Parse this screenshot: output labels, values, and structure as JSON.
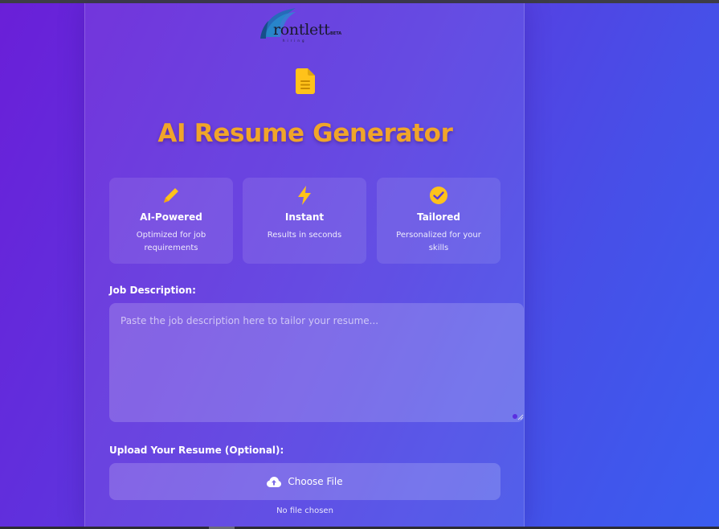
{
  "brand": {
    "name": "rontlett",
    "badge": "BETA",
    "tagline": "hiring"
  },
  "page": {
    "title": "AI Resume Generator",
    "title_color": "#f0a52a",
    "accent_color": "#ffc21a"
  },
  "features": [
    {
      "icon": "pencil-icon",
      "title": "AI-Powered",
      "description": "Optimized for job requirements"
    },
    {
      "icon": "lightning-icon",
      "title": "Instant",
      "description": "Results in seconds"
    },
    {
      "icon": "check-circle-icon",
      "title": "Tailored",
      "description": "Personalized for your skills"
    }
  ],
  "job_description": {
    "label": "Job Description:",
    "placeholder": "Paste the job description here to tailor your resume...",
    "value": ""
  },
  "upload": {
    "label": "Upload Your Resume (Optional):",
    "button_label": "Choose File",
    "icon": "cloud-upload-icon",
    "status": "No file chosen"
  }
}
